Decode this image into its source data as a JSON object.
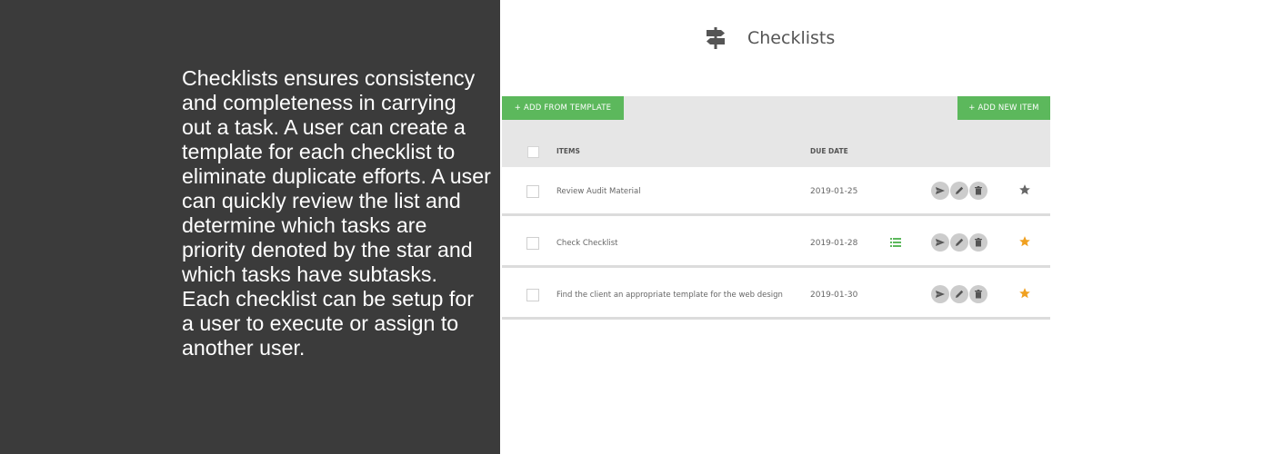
{
  "description": "Checklists ensures consistency and completeness in carrying out a task. A user can create a template for each checklist to eliminate duplicate efforts. A user can quickly review the list and determine which tasks are priority denoted by the star and which tasks have subtasks. Each checklist can be setup for a user to execute or assign to another user.",
  "header": {
    "title": "Checklists",
    "icon": "signpost-icon"
  },
  "toolbar": {
    "add_template_label": "+ ADD FROM TEMPLATE",
    "add_item_label": "+ ADD NEW ITEM"
  },
  "table": {
    "columns": {
      "items": "ITEMS",
      "due_date": "DUE DATE"
    },
    "rows": [
      {
        "item": "Review Audit Material",
        "due": "2019-01-25",
        "has_subtasks": false,
        "priority_star_color": "#666666"
      },
      {
        "item": "Check Checklist",
        "due": "2019-01-28",
        "has_subtasks": true,
        "priority_star_color": "#f0a020"
      },
      {
        "item": "Find the client an appropriate template for the web design",
        "due": "2019-01-30",
        "has_subtasks": false,
        "priority_star_color": "#f0a020"
      }
    ]
  },
  "colors": {
    "accent_green": "#5cb85c",
    "left_panel_bg": "#3b3b3b",
    "star_gold": "#f0a020"
  }
}
